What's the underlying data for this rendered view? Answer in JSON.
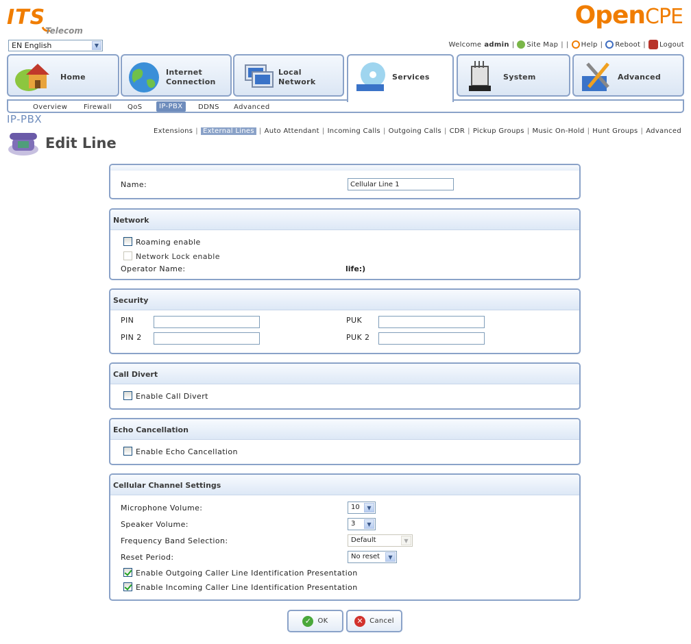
{
  "brand": {
    "its": "ITS",
    "telecom": "Telecom",
    "opencpe_open": "Open",
    "opencpe_cpe": "CPE"
  },
  "language": {
    "selected": "EN English"
  },
  "top_links": {
    "welcome": "Welcome",
    "user": "admin",
    "site_map": "Site Map",
    "help": "Help",
    "reboot": "Reboot",
    "logout": "Logout"
  },
  "tabs": [
    {
      "label": "Home"
    },
    {
      "label": "Internet\nConnection",
      "line1": "Internet",
      "line2": "Connection"
    },
    {
      "label": "Local\nNetwork",
      "line1": "Local",
      "line2": "Network"
    },
    {
      "label": "Services"
    },
    {
      "label": "System"
    },
    {
      "label": "Advanced"
    }
  ],
  "subnav": [
    "Overview",
    "Firewall",
    "QoS",
    "IP-PBX",
    "DDNS",
    "Advanced"
  ],
  "page": {
    "category": "IP-PBX",
    "title": "Edit Line"
  },
  "subtabs": [
    "Extensions",
    "External Lines",
    "Auto Attendant",
    "Incoming Calls",
    "Outgoing Calls",
    "CDR",
    "Pickup Groups",
    "Music On-Hold",
    "Hunt Groups",
    "Advanced"
  ],
  "name_panel": {
    "label": "Name:",
    "value": "Cellular Line 1"
  },
  "network": {
    "title": "Network",
    "roaming": "Roaming enable",
    "network_lock": "Network Lock enable",
    "operator_label": "Operator Name:",
    "operator_value": "life:)"
  },
  "security": {
    "title": "Security",
    "pin": "PIN",
    "pin2": "PIN 2",
    "puk": "PUK",
    "puk2": "PUK 2"
  },
  "call_divert": {
    "title": "Call Divert",
    "enable": "Enable Call Divert"
  },
  "echo": {
    "title": "Echo Cancellation",
    "enable": "Enable Echo Cancellation"
  },
  "cellular": {
    "title": "Cellular Channel Settings",
    "mic_label": "Microphone Volume:",
    "mic_value": "10",
    "speaker_label": "Speaker Volume:",
    "speaker_value": "3",
    "band_label": "Frequency Band Selection:",
    "band_value": "Default",
    "reset_label": "Reset Period:",
    "reset_value": "No reset",
    "outgoing_clip": "Enable Outgoing Caller Line Identification Presentation",
    "incoming_clip": "Enable Incoming Caller Line Identification Presentation"
  },
  "buttons": {
    "ok": "OK",
    "cancel": "Cancel"
  },
  "colors": {
    "accent": "#f07d00",
    "border": "#8aa2c8",
    "active_tab": "#6e8cbc"
  }
}
